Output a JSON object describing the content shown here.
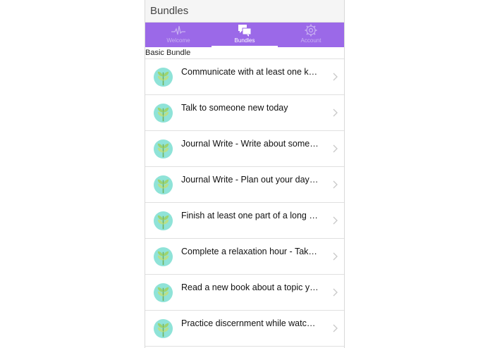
{
  "header": {
    "title": "Bundles"
  },
  "tabs": [
    {
      "label": "Welcome",
      "icon": "heartbeat-icon",
      "active": false
    },
    {
      "label": "Bundles",
      "icon": "chat-bubbles-icon",
      "active": true
    },
    {
      "label": "Account",
      "icon": "gear-icon",
      "active": false
    }
  ],
  "section": {
    "label": "Basic Bundle"
  },
  "items": [
    {
      "text": "Communicate with at least one kno…",
      "icon": "plant-icon"
    },
    {
      "text": "Talk to someone new today",
      "icon": "plant-icon"
    },
    {
      "text": "Journal Write - Write about some thi…",
      "icon": "plant-icon"
    },
    {
      "text": "Journal Write - Plan out your day for…",
      "icon": "plant-icon"
    },
    {
      "text": "Finish at least one part of a long tim…",
      "icon": "plant-icon"
    },
    {
      "text": "Complete a relaxation hour - Take ti…",
      "icon": "plant-icon"
    },
    {
      "text": "Read a new book about a topic you …",
      "icon": "plant-icon"
    },
    {
      "text": "Practice discernment while watching…",
      "icon": "plant-icon"
    }
  ],
  "colors": {
    "tab_bar": "#9b69e8",
    "tab_inactive": "#c9b2f2",
    "tab_active": "#ffffff",
    "icon_circle": "#8fe3d8",
    "plant_green": "#7cc36a"
  }
}
